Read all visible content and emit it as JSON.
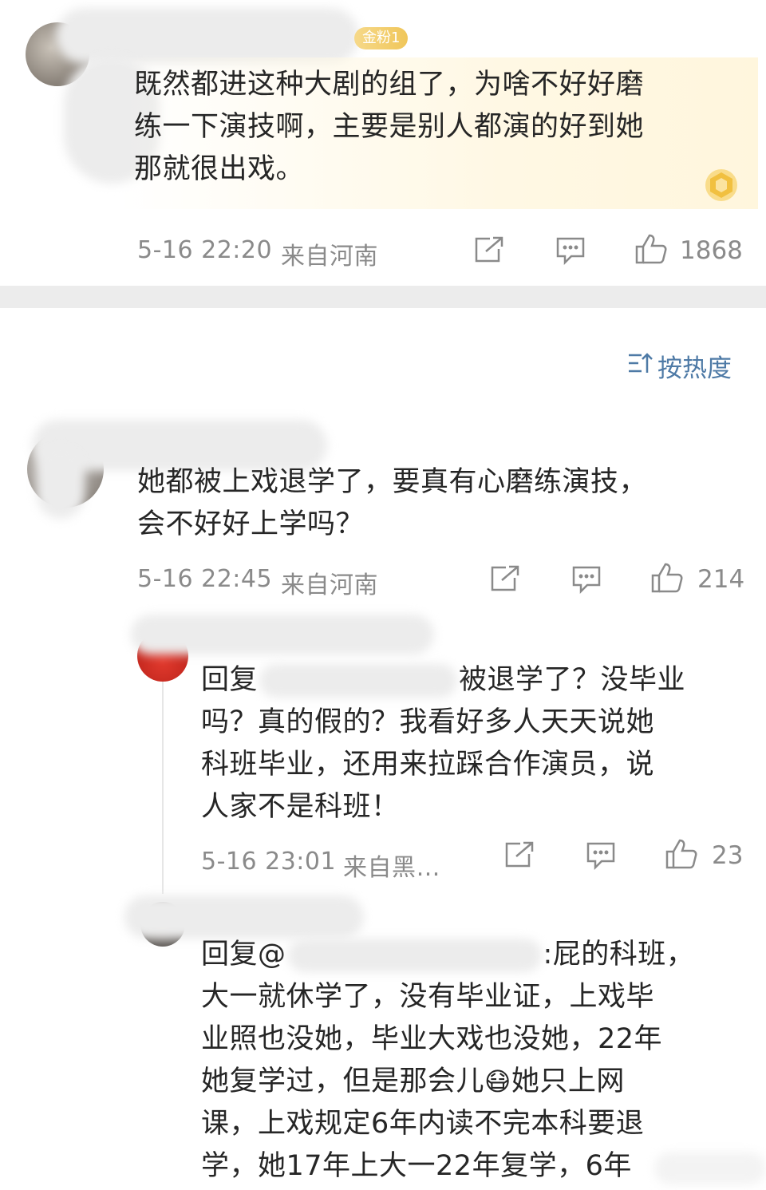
{
  "comments": [
    {
      "badge": "金粉1",
      "text": [
        "既然都进这种大剧的组了，为啥不好好磨",
        "练一下演技啊，主要是别人都演的好到她",
        "那就很出戏。"
      ],
      "date": "5-16 22:20",
      "location": "来自河南",
      "likes": "1868"
    },
    {
      "text": [
        "她都被上戏退学了，要真有心磨练演技，",
        "会不好好上学吗？"
      ],
      "date": "5-16 22:45",
      "location": "来自河南",
      "likes": "214"
    }
  ],
  "sort_label": "按热度",
  "replies": [
    {
      "reply_prefix": "回复",
      "line1_tail": "被退学了？没毕业",
      "text": [
        "吗？真的假的？我看好多人天天说她",
        "科班毕业，还用来拉踩合作演员，说",
        "人家不是科班！"
      ],
      "date": "5-16 23:01",
      "location": "来自黑…",
      "likes": "23"
    },
    {
      "reply_prefix": "回复@",
      "line1_tail": ":屁的科班，",
      "text": [
        "大一就休学了，没有毕业证，上戏毕",
        "业照也没她，毕业大戏也没她，22年",
        "她复学过，但是那会儿",
        "她只上网",
        "课，上戏规定6年内读不完本科要退",
        "学，她17年上大一22年复学，6年"
      ],
      "emoji": "😷"
    }
  ]
}
